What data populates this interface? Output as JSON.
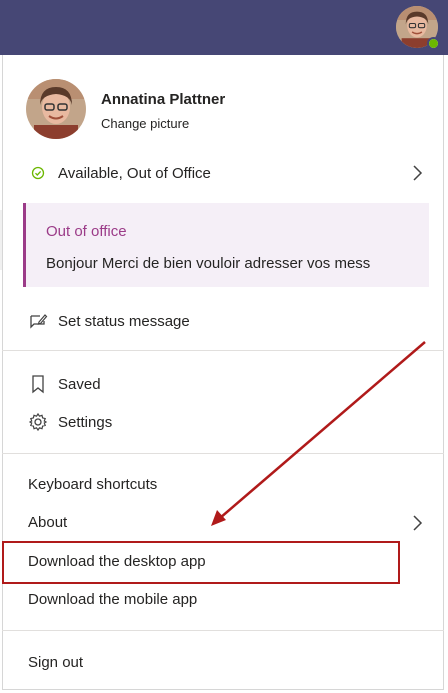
{
  "profile": {
    "name": "Annatina Plattner",
    "change_picture": "Change picture"
  },
  "status": {
    "label": "Available, Out of Office"
  },
  "out_of_office": {
    "title": "Out of office",
    "message": "Bonjour Merci de bien vouloir adresser vos mess"
  },
  "menu": {
    "set_status": "Set status message",
    "saved": "Saved",
    "settings": "Settings",
    "keyboard_shortcuts": "Keyboard shortcuts",
    "about": "About",
    "download_desktop": "Download the desktop app",
    "download_mobile": "Download the mobile app",
    "sign_out": "Sign out"
  },
  "icons": {
    "available": "check-circle-icon",
    "set_status": "edit-message-icon",
    "saved": "bookmark-icon",
    "settings": "gear-icon",
    "chevron": "chevron-right-icon"
  },
  "colors": {
    "topbar": "#464775",
    "available": "#6bb700",
    "ooo_accent": "#9b3b88",
    "ooo_background": "#f5eff7",
    "annotation": "#b01a1a"
  }
}
